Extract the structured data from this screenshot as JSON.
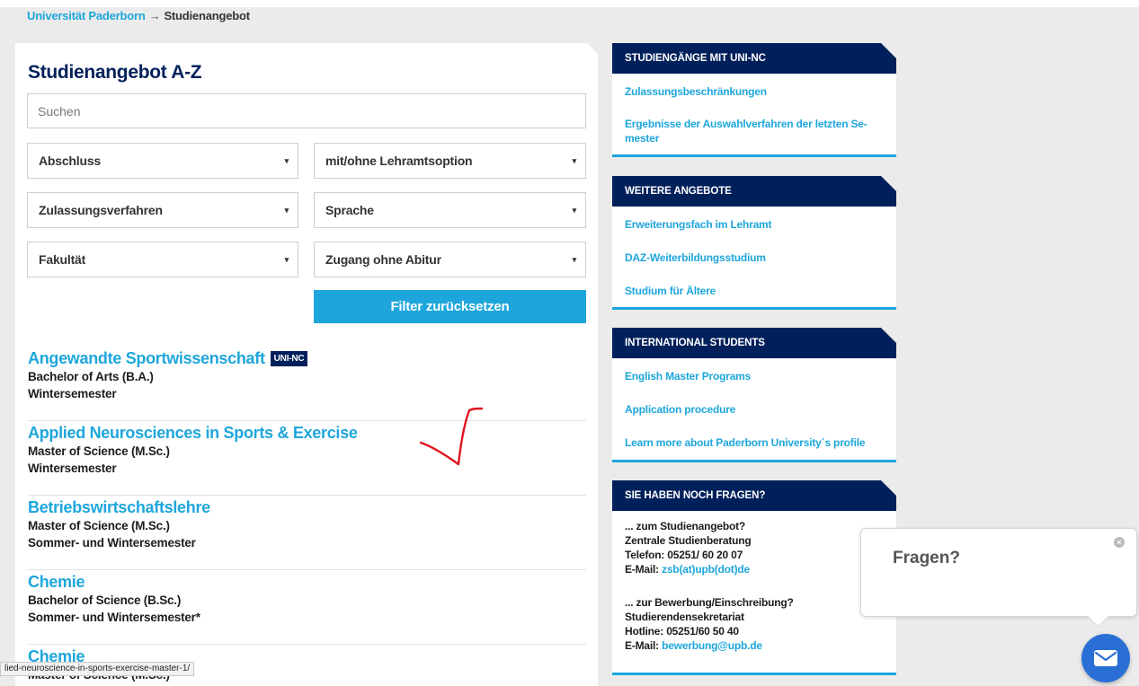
{
  "breadcrumb": {
    "home": "Universität Paderborn",
    "separator": "→",
    "current": "Studienangebot"
  },
  "main": {
    "title": "Studienangebot A-Z",
    "search_placeholder": "Suchen",
    "filters": {
      "abschluss": "Abschluss",
      "lehramt": "mit/ohne Lehramtsoption",
      "zulassung": "Zulassungsverfahren",
      "sprache": "Sprache",
      "fakultaet": "Fakultät",
      "zugang": "Zugang ohne Abitur",
      "caret": "▾"
    },
    "reset_label": "Filter zurücksetzen",
    "results": [
      {
        "title": "Angewandte Sportwissenschaft",
        "badge": "UNI-NC",
        "degree": "Bachelor of Arts (B.A.)",
        "semester": "Wintersemester"
      },
      {
        "title": "Applied Neurosciences in Sports & Exercise",
        "degree": "Master of Science (M.Sc.)",
        "semester": "Wintersemester"
      },
      {
        "title": "Betriebswirtschaftslehre",
        "degree": "Master of Science (M.Sc.)",
        "semester": "Sommer- und Wintersemester"
      },
      {
        "title": "Chemie",
        "degree": "Bachelor of Science (B.Sc.)",
        "semester": "Sommer- und Wintersemester*"
      },
      {
        "title": "Chemie",
        "degree": "Master of Science (M.Sc.)",
        "semester": ""
      }
    ]
  },
  "sidebar": {
    "nc": {
      "heading": "STUDIENGÄNGE MIT UNI-NC",
      "links": [
        "Zulassungsbeschränkungen",
        "Ergebnisse der Auswahlverfahren der letzten Se-",
        "mester"
      ]
    },
    "weitere": {
      "heading": "WEITERE ANGEBOTE",
      "links": [
        "Erweiterungsfach im Lehramt",
        "DAZ-Weiterbildungsstudium",
        "Studium für Ältere"
      ]
    },
    "international": {
      "heading": "INTERNATIONAL STUDENTS",
      "links": [
        "English Master Programs",
        "Application procedure",
        "Learn more about Paderborn University´s profile"
      ]
    },
    "fragen": {
      "heading": "SIE HABEN NOCH FRAGEN?",
      "block1": [
        "... zum Studienangebot?",
        "Zentrale Studienberatung",
        "Telefon: 05251/ 60 20 07"
      ],
      "email1_label": "E-Mail:",
      "email1": "zsb(at)upb(dot)de",
      "block2": [
        "... zur Bewerbung/Einschreibung?",
        "Studierendensekretariat",
        "Hotline: 05251/60 50 40"
      ],
      "email2_label": "E-Mail:",
      "email2": "bewerbung@upb.de"
    }
  },
  "chat": {
    "prompt": "Fragen?",
    "close": "×"
  },
  "status_url": "lied-neuroscience-in-sports-exercise-master-1/",
  "colors": {
    "navy": "#00205b",
    "cyan": "#1ea6dc",
    "chat_blue": "#2a6fd6",
    "annotation_red": "#e0141e"
  }
}
